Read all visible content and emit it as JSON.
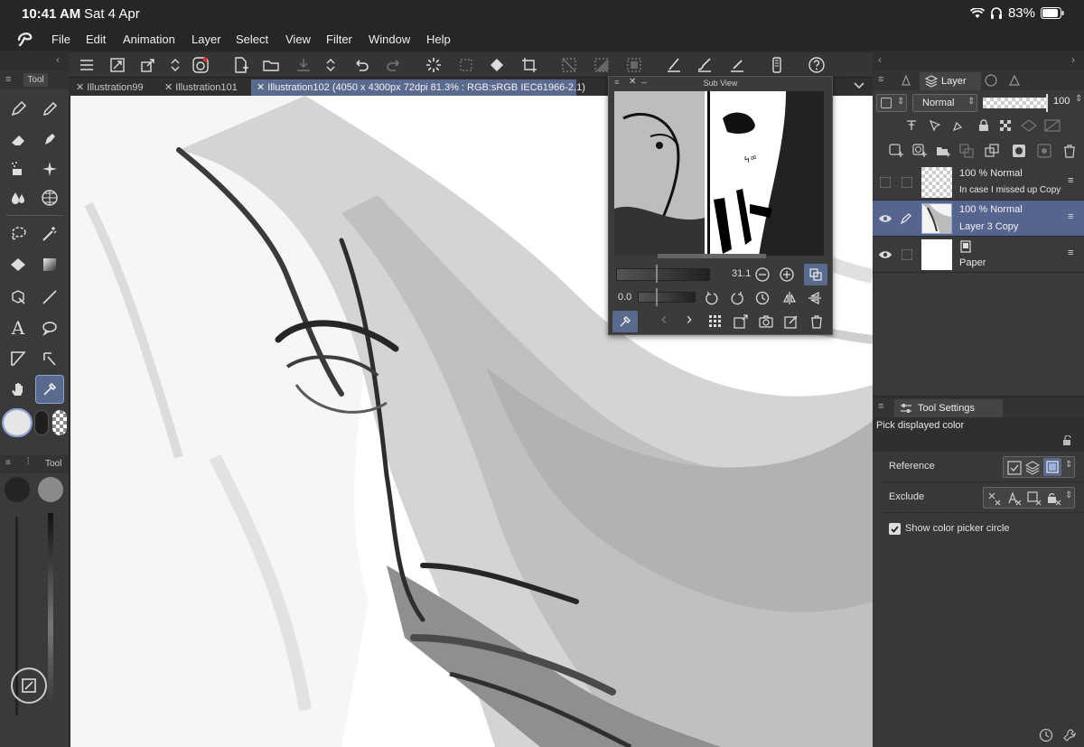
{
  "status_bar": {
    "time": "10:41 AM",
    "date": "Sat 4 Apr",
    "battery": "83%"
  },
  "menu": {
    "items": [
      "File",
      "Edit",
      "Animation",
      "Layer",
      "Select",
      "View",
      "Filter",
      "Window",
      "Help"
    ]
  },
  "tool_panel": {
    "title": "Tool",
    "sub_title": "Tool"
  },
  "tabs": [
    {
      "label": "Illustration99"
    },
    {
      "label": "Illustration101"
    },
    {
      "label": "Illustration102 (4050 x 4300px 72dpi 81.3% : RGB:sRGB IEC61966-2.1)"
    }
  ],
  "sub_view": {
    "title": "Sub View",
    "zoom_value": "31.1",
    "rotate_value": "0.0"
  },
  "layer_panel": {
    "tab_label": "Layer",
    "blend_mode": "Normal",
    "opacity_value": "100",
    "layers": [
      {
        "opacity_mode": "100 %  Normal",
        "name": "In case I missed up  Copy"
      },
      {
        "opacity_mode": "100 %  Normal",
        "name": "Layer 3 Copy"
      },
      {
        "name": "Paper"
      }
    ]
  },
  "tool_settings": {
    "tab_label": "Tool Settings",
    "tool_name": "Pick displayed color",
    "reference_label": "Reference",
    "exclude_label": "Exclude",
    "show_circle_label": "Show color picker circle",
    "show_circle_checked": true
  },
  "colors": {
    "accent": "#5a6a8f",
    "panel_bg": "#3a3a3a",
    "canvas_bg": "#ffffff"
  }
}
